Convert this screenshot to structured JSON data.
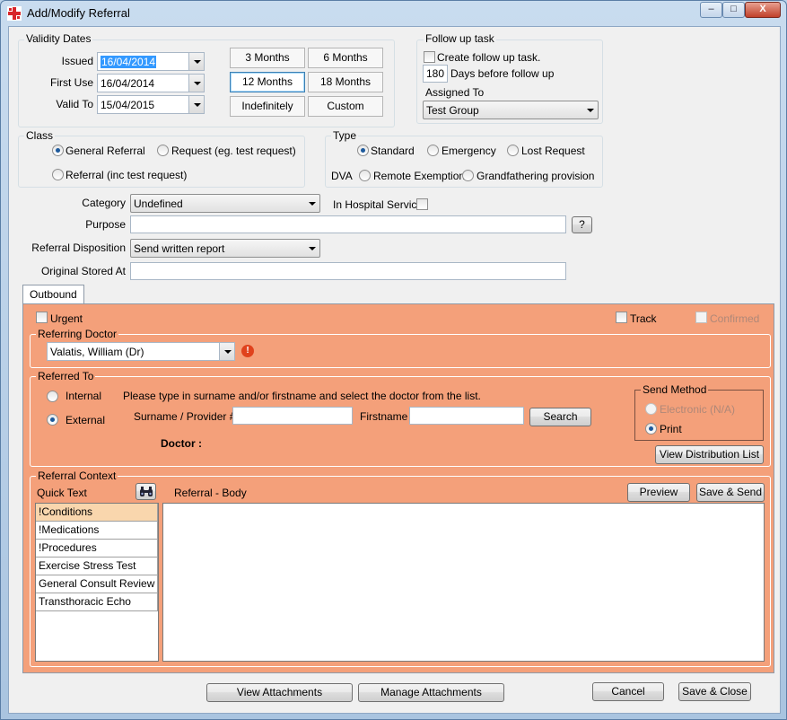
{
  "window": {
    "title": "Add/Modify Referral",
    "minimize": "–",
    "maximize": "□",
    "close": "X"
  },
  "validity": {
    "title": "Validity Dates",
    "issued_label": "Issued",
    "issued_value": "16/04/2014",
    "first_use_label": "First Use",
    "first_use_value": "16/04/2014",
    "valid_to_label": "Valid To",
    "valid_to_value": "15/04/2015",
    "buttons": [
      "3 Months",
      "6 Months",
      "12 Months",
      "18 Months",
      "Indefinitely",
      "Custom"
    ]
  },
  "follow_up": {
    "title": "Follow up task",
    "create_label": "Create follow up task.",
    "days_value": "180",
    "days_label": "Days before follow up",
    "assigned_label": "Assigned To",
    "assigned_value": "Test Group"
  },
  "class": {
    "title": "Class",
    "general": "General Referral",
    "request": "Request (eg. test request)",
    "referral_inc": "Referral (inc test request)"
  },
  "type": {
    "title": "Type",
    "standard": "Standard",
    "emergency": "Emergency",
    "lost": "Lost Request",
    "dva_label": "DVA",
    "remote": "Remote Exemption",
    "grandfathering": "Grandfathering provision"
  },
  "fields": {
    "category_label": "Category",
    "category_value": "Undefined",
    "in_hospital_label": "In Hospital Service",
    "purpose_label": "Purpose",
    "purpose_value": "",
    "help": "?",
    "disposition_label": "Referral Disposition",
    "disposition_value": "Send written report",
    "stored_label": "Original Stored At",
    "stored_value": ""
  },
  "tabs": {
    "outbound": "Outbound"
  },
  "outbound": {
    "urgent": "Urgent",
    "track": "Track",
    "confirmed": "Confirmed",
    "referring_title": "Referring Doctor",
    "referring_value": "Valatis, William (Dr)",
    "warn": "!",
    "referred_title": "Referred To",
    "internal": "Internal",
    "external": "External",
    "instructions": "Please type in surname and/or firstname and select the doctor from the list.",
    "surname_label": "Surname / Provider #",
    "firstname_label": "Firstname",
    "search": "Search",
    "doctor_label": "Doctor :",
    "send_method_title": "Send Method",
    "electronic": "Electronic (N/A)",
    "print": "Print",
    "view_dist": "View Distribution List",
    "context_title": "Referral Context",
    "quick_text": "Quick Text",
    "body_label": "Referral - Body",
    "preview": "Preview",
    "save_send": "Save & Send",
    "quick_items": [
      "!Conditions",
      "!Medications",
      "!Procedures",
      "Exercise Stress Test",
      "General Consult Review",
      "Transthoracic Echo"
    ]
  },
  "footer": {
    "view_attachments": "View Attachments",
    "manage_attachments": "Manage Attachments",
    "cancel": "Cancel",
    "save_close": "Save & Close"
  },
  "colors": {
    "panel": "#f4a07a",
    "selection": "#3399ff",
    "selected_item": "#f9d6ad"
  }
}
